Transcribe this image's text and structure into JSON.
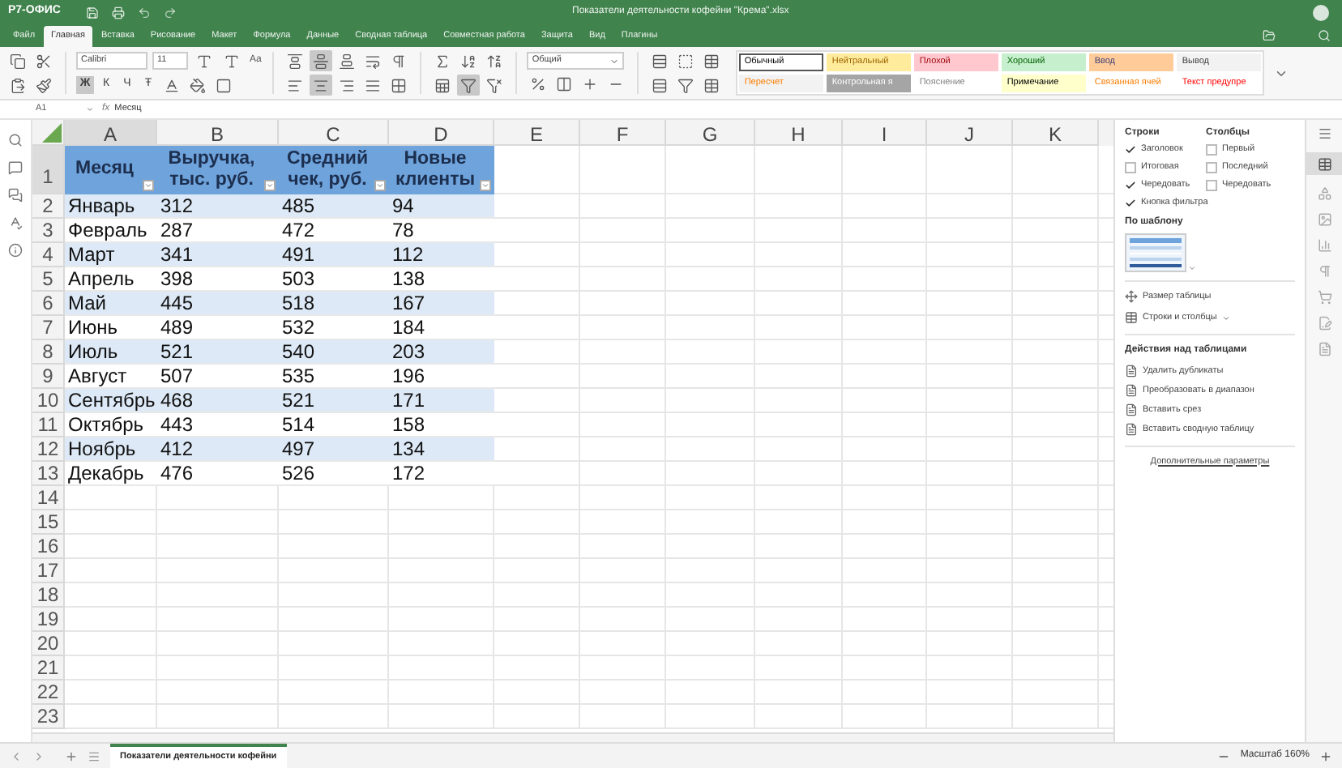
{
  "titlebar": {
    "logo": "Р7-ОФИС",
    "title": "Показатели деятельности кофейни \"Крема\".xlsx"
  },
  "menu_tabs": [
    {
      "label": "Файл",
      "selected": false
    },
    {
      "label": "Главная",
      "selected": true
    },
    {
      "label": "Вставка",
      "selected": false
    },
    {
      "label": "Рисование",
      "selected": false
    },
    {
      "label": "Макет",
      "selected": false
    },
    {
      "label": "Формула",
      "selected": false
    },
    {
      "label": "Данные",
      "selected": false
    },
    {
      "label": "Сводная таблица",
      "selected": false
    },
    {
      "label": "Совместная работа",
      "selected": false
    },
    {
      "label": "Защита",
      "selected": false
    },
    {
      "label": "Вид",
      "selected": false
    },
    {
      "label": "Плагины",
      "selected": false
    }
  ],
  "ribbon": {
    "font_name": "Calibri",
    "font_size": "11",
    "case_button": "Aa",
    "number_format": "Общий",
    "text_format": [
      {
        "label": "Ж",
        "selected": true
      },
      {
        "label": "К",
        "selected": false
      },
      {
        "label": "Ч",
        "selected": false
      },
      {
        "label": "Ŧ",
        "selected": false
      }
    ],
    "cell_styles": [
      {
        "label": "Обычный",
        "color": "#ffffff",
        "selected": true
      },
      {
        "label": "Нейтральный",
        "color": "#ffeb9c",
        "selected": false
      },
      {
        "label": "Плохой",
        "color": "#ffc7ce",
        "selected": false
      },
      {
        "label": "Хороший",
        "color": "#c6efce",
        "selected": false
      },
      {
        "label": "Ввод",
        "color": "#ffcc99",
        "selected": false
      },
      {
        "label": "Вывод",
        "color": "#f2f2f2",
        "selected": false
      },
      {
        "label": "Пересчет",
        "color": "#f2f2f2",
        "selected": false
      },
      {
        "label": "Контрольная я",
        "color": "#a5a5a5",
        "selected": false
      },
      {
        "label": "Пояснение",
        "color": "#ffffff",
        "selected": false
      },
      {
        "label": "Примечание",
        "color": "#ffffcc",
        "selected": false
      },
      {
        "label": "Связанная ячей",
        "color": "#ffffff",
        "selected": false
      },
      {
        "label": "Текст предупре",
        "color": "#ffffff",
        "selected": false
      }
    ]
  },
  "formula_bar": {
    "cell": "A1",
    "fx": "fx",
    "value": "Месяц"
  },
  "sheet": {
    "columns": [
      {
        "label": "A",
        "selected": true
      },
      {
        "label": "B",
        "selected": false
      },
      {
        "label": "C",
        "selected": false
      },
      {
        "label": "D",
        "selected": false
      },
      {
        "label": "E",
        "selected": false
      },
      {
        "label": "F",
        "selected": false
      },
      {
        "label": "G",
        "selected": false
      },
      {
        "label": "H",
        "selected": false
      },
      {
        "label": "I",
        "selected": false
      },
      {
        "label": "J",
        "selected": false
      },
      {
        "label": "K",
        "selected": false
      }
    ],
    "header_row": {
      "number": "1",
      "cells": [
        "Месяц",
        "Выручка, тыс. руб.",
        "Средний чек, руб.",
        "Новые клиенты"
      ]
    },
    "rows": [
      {
        "number": "2",
        "cells": [
          "Январь",
          "312",
          "485",
          "94"
        ]
      },
      {
        "number": "3",
        "cells": [
          "Февраль",
          "287",
          "472",
          "78"
        ]
      },
      {
        "number": "4",
        "cells": [
          "Март",
          "341",
          "491",
          "112"
        ]
      },
      {
        "number": "5",
        "cells": [
          "Апрель",
          "398",
          "503",
          "138"
        ]
      },
      {
        "number": "6",
        "cells": [
          "Май",
          "445",
          "518",
          "167"
        ]
      },
      {
        "number": "7",
        "cells": [
          "Июнь",
          "489",
          "532",
          "184"
        ]
      },
      {
        "number": "8",
        "cells": [
          "Июль",
          "521",
          "540",
          "203"
        ]
      },
      {
        "number": "9",
        "cells": [
          "Август",
          "507",
          "535",
          "196"
        ]
      },
      {
        "number": "10",
        "cells": [
          "Сентябрь",
          "468",
          "521",
          "171"
        ]
      },
      {
        "number": "11",
        "cells": [
          "Октябрь",
          "443",
          "514",
          "158"
        ]
      },
      {
        "number": "12",
        "cells": [
          "Ноябрь",
          "412",
          "497",
          "134"
        ]
      },
      {
        "number": "13",
        "cells": [
          "Декабрь",
          "476",
          "526",
          "172"
        ]
      }
    ],
    "empty_rows": [
      "14",
      "15",
      "16",
      "17",
      "18",
      "19",
      "20",
      "21",
      "22",
      "23"
    ]
  },
  "table_panel": {
    "rows_label": "Строки",
    "columns_label": "Столбцы",
    "row_options": [
      {
        "kind": "header",
        "label": "Заголовок",
        "checked": true
      },
      {
        "kind": "total",
        "label": "Итоговая",
        "checked": false
      },
      {
        "kind": "banded",
        "label": "Чередовать",
        "checked": true
      },
      {
        "kind": "filter",
        "label": "Кнопка фильтра",
        "checked": true
      }
    ],
    "column_options": [
      {
        "label": "Первый",
        "checked": false
      },
      {
        "label": "Последний",
        "checked": false
      },
      {
        "label": "Чередовать",
        "checked": false
      }
    ],
    "template_label": "По шаблону",
    "resize": "Размер таблицы",
    "rows_columns": "Строки и столбцы",
    "actions_title": "Действия над таблицами",
    "actions": [
      "Удалить дубликаты",
      "Преобразовать в диапазон",
      "Вставить срез",
      "Вставить сводную таблицу"
    ],
    "advanced": "Дополнительные параметры"
  },
  "sheet_tabs": [
    {
      "label": "Показатели деятельности кофейни",
      "selected": true
    }
  ],
  "zoom": "Масштаб 160%"
}
